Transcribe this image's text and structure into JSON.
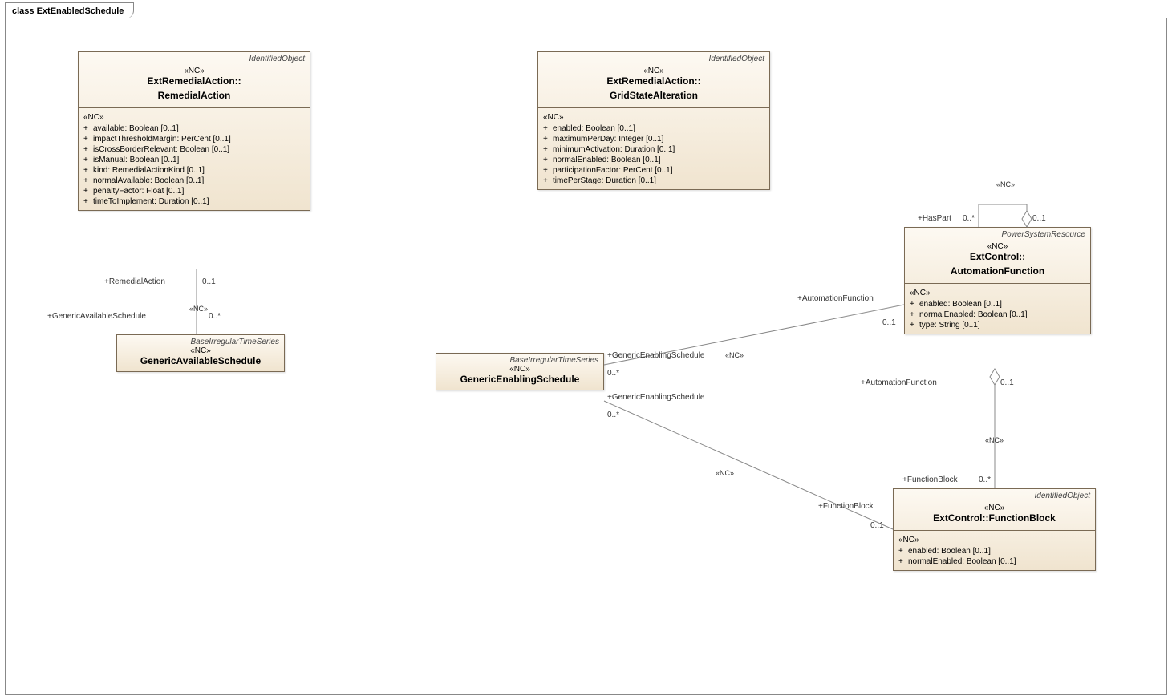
{
  "frame_title": "class ExtEnabledSchedule",
  "stereo_nc": "«NC»",
  "remedial_action": {
    "super": "IdentifiedObject",
    "name1": "ExtRemedialAction::",
    "name2": "RemedialAction",
    "attrs": [
      "available: Boolean [0..1]",
      "impactThresholdMargin: PerCent [0..1]",
      "isCrossBorderRelevant: Boolean [0..1]",
      "isManual: Boolean [0..1]",
      "kind: RemedialActionKind [0..1]",
      "normalAvailable: Boolean [0..1]",
      "penaltyFactor: Float [0..1]",
      "timeToImplement: Duration [0..1]"
    ]
  },
  "grid_state": {
    "super": "IdentifiedObject",
    "name1": "ExtRemedialAction::",
    "name2": "GridStateAlteration",
    "attrs": [
      "enabled: Boolean [0..1]",
      "maximumPerDay: Integer [0..1]",
      "minimumActivation: Duration [0..1]",
      "normalEnabled: Boolean [0..1]",
      "participationFactor: PerCent [0..1]",
      "timePerStage: Duration [0..1]"
    ]
  },
  "automation_function": {
    "super": "PowerSystemResource",
    "name1": "ExtControl::",
    "name2": "AutomationFunction",
    "attrs": [
      "enabled: Boolean [0..1]",
      "normalEnabled: Boolean [0..1]",
      "type: String [0..1]"
    ]
  },
  "function_block": {
    "super": "IdentifiedObject",
    "name": "ExtControl::FunctionBlock",
    "attrs": [
      "enabled: Boolean [0..1]",
      "normalEnabled: Boolean [0..1]"
    ]
  },
  "generic_available": {
    "super": "BaseIrregularTimeSeries",
    "name": "GenericAvailableSchedule"
  },
  "generic_enabling": {
    "super": "BaseIrregularTimeSeries",
    "name": "GenericEnablingSchedule"
  },
  "labels": {
    "remedial_action_role": "+RemedialAction",
    "remedial_action_mult": "0..1",
    "gen_avail_role": "+GenericAvailableSchedule",
    "gen_avail_mult": "0..*",
    "gen_enable_role1": "+GenericEnablingSchedule",
    "gen_enable_mult1": "0..*",
    "gen_enable_role2": "+GenericEnablingSchedule",
    "gen_enable_mult2": "0..*",
    "autofunc_role1": "+AutomationFunction",
    "autofunc_mult1": "0..1",
    "autofunc_role2": "+AutomationFunction",
    "autofunc_mult2": "0..1",
    "funcblock_role1": "+FunctionBlock",
    "funcblock_mult1": "0..1",
    "funcblock_role2": "+FunctionBlock",
    "funcblock_mult2": "0..*",
    "haspart_role": "+HasPart",
    "haspart_mult": "0..*",
    "haspart_other_mult": "0..1"
  }
}
